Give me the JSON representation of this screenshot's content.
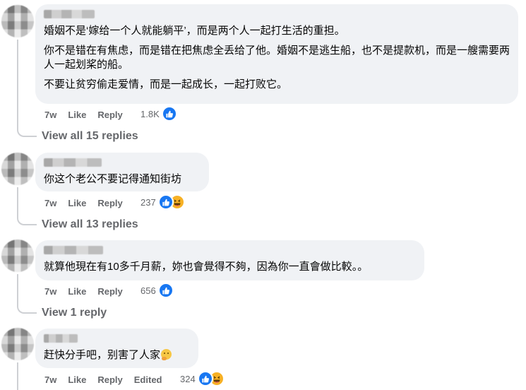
{
  "comments": [
    {
      "paragraphs": [
        "婚姻不是‘嫁给一个人就能躺平’，而是两个人一起打生活的重担。",
        "你不是错在有焦虑，而是错在把焦虑全丢给了他。婚姻不是逃生船，也不是提款机，而是一艘需要两人一起划桨的船。",
        "不要让贫穷偷走爱情，而是一起成长，一起打败它。"
      ],
      "time": "7w",
      "like": "Like",
      "reply": "Reply",
      "reaction_count": "1.8K",
      "reactions": [
        "like-icon"
      ],
      "view_replies": "View all 15 replies"
    },
    {
      "paragraphs": [
        "你这个老公不要记得通知街坊"
      ],
      "time": "7w",
      "like": "Like",
      "reply": "Reply",
      "reaction_count": "237",
      "reactions": [
        "like-icon",
        "haha-icon"
      ],
      "view_replies": "View all 13 replies"
    },
    {
      "paragraphs": [
        "就算他現在有10多千月薪，妳也會覺得不夠，因為你一直會做比較。。"
      ],
      "time": "7w",
      "like": "Like",
      "reply": "Reply",
      "reaction_count": "656",
      "reactions": [
        "like-icon"
      ],
      "view_replies": "View 1 reply"
    },
    {
      "paragraphs": [
        "赶快分手吧，别害了人家"
      ],
      "time": "7w",
      "like": "Like",
      "reply": "Reply",
      "edited": "Edited",
      "reaction_count": "324",
      "reactions": [
        "like-icon",
        "haha-icon"
      ]
    }
  ],
  "colors": {
    "bubble": "#f0f2f5",
    "meta": "#65676b",
    "like_blue": "#1877f2",
    "haha_yellow": "#f7b125"
  }
}
